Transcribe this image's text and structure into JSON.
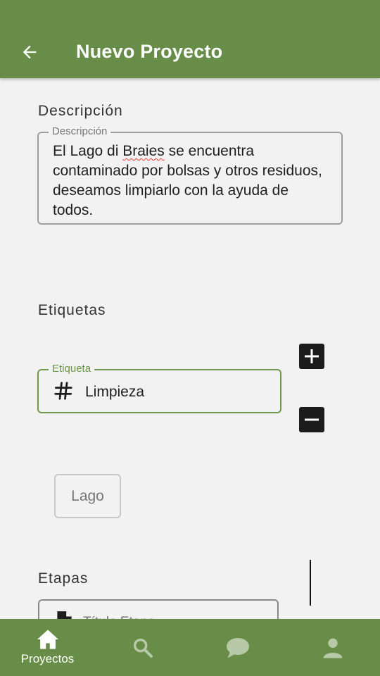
{
  "header": {
    "title": "Nuevo Proyecto",
    "back_icon": "arrow-left-icon"
  },
  "description": {
    "section_title": "Descripción",
    "field_label": "Descripción",
    "text_before": "El Lago di ",
    "text_misspelled": "Braies",
    "text_after": " se encuentra contaminado por bolsas y otros residuos, deseamos limpiarlo con la ayuda de todos."
  },
  "tags": {
    "section_title": "Etiquetas",
    "field_label": "Etiqueta",
    "field_value": "Limpieza",
    "field_icon": "hash-icon",
    "add_icon": "plus-icon",
    "remove_icon": "minus-icon",
    "chips": [
      "Lago"
    ]
  },
  "stages": {
    "section_title": "Etapas",
    "field_placeholder": "Título Etapa",
    "field_icon": "document-icon"
  },
  "bottom_nav": {
    "items": [
      {
        "label": "Proyectos",
        "icon": "home-icon",
        "active": true
      },
      {
        "label": "",
        "icon": "search-icon",
        "active": false
      },
      {
        "label": "",
        "icon": "chat-icon",
        "active": false
      },
      {
        "label": "",
        "icon": "person-icon",
        "active": false
      }
    ]
  },
  "colors": {
    "primary": "#678d48",
    "focus_border": "#6f9a4d",
    "background": "#f2f2f2",
    "inactive_icon": "#b7c9a6",
    "spell_error": "#e53935"
  }
}
